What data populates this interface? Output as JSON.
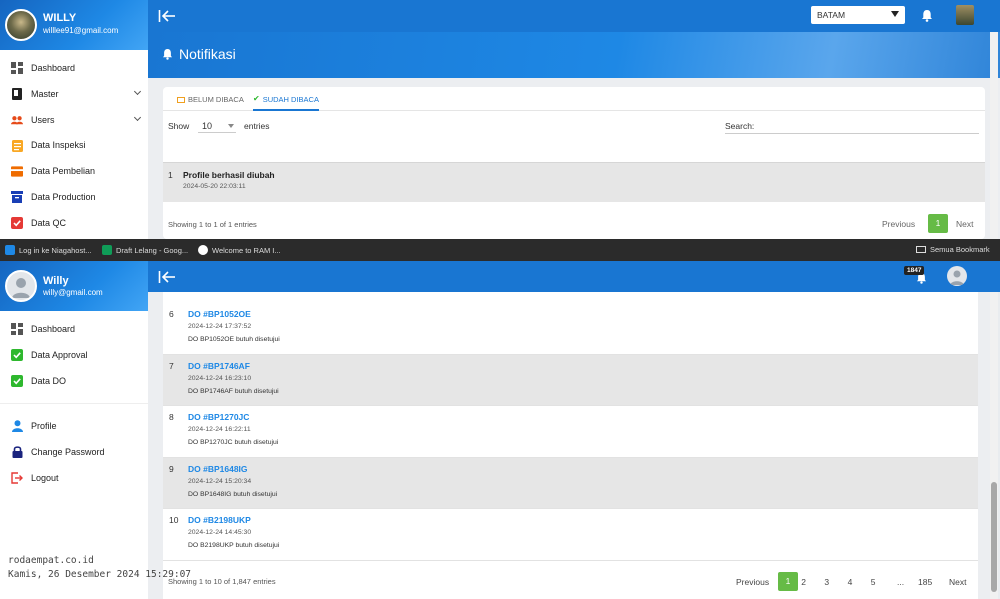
{
  "top": {
    "user": {
      "name": "WILLY",
      "email": "willlee91@gmail.com"
    },
    "menu": [
      {
        "label": "Dashboard",
        "icon": "dashboard-icon",
        "color": "#555555"
      },
      {
        "label": "Master",
        "icon": "book-icon",
        "color": "#222222",
        "has_submenu": true
      },
      {
        "label": "Users",
        "icon": "users-icon",
        "color": "#e64a19",
        "has_submenu": true
      },
      {
        "label": "Data Inspeksi",
        "icon": "clipboard-icon",
        "color": "#f9a825"
      },
      {
        "label": "Data Pembelian",
        "icon": "receipt-icon",
        "color": "#ef6c00"
      },
      {
        "label": "Data Production",
        "icon": "archive-icon",
        "color": "#1a3fb5"
      },
      {
        "label": "Data QC",
        "icon": "check-square-icon",
        "color": "#e53935"
      }
    ],
    "location_select": "BATAM",
    "page_title": "Notifikasi",
    "tabs": [
      {
        "label": "BELUM DIBACA",
        "icon": "envelope-icon",
        "active": false
      },
      {
        "label": "SUDAH DIBACA",
        "icon": "check-icon",
        "active": true
      }
    ],
    "show_label": "Show",
    "entries_value": "10",
    "entries_label": "entries",
    "search_label": "Search:",
    "rows": [
      {
        "no": "1",
        "title": "Profile berhasil diubah",
        "time": "2024-05-20 22:03:11"
      }
    ],
    "info": "Showing 1 to 1 of 1 entries",
    "pagination": {
      "prev": "Previous",
      "pages": [
        "1"
      ],
      "next": "Next"
    }
  },
  "bookmarks": {
    "items": [
      {
        "label": "Log in ke Niagahost...",
        "color": "#1e88e5"
      },
      {
        "label": "Draft Lelang - Goog...",
        "color": "#0f9d58"
      },
      {
        "label": "Welcome to RAM I...",
        "color": "#ffffff"
      }
    ],
    "folder": "Semua Bookmark"
  },
  "bottom": {
    "user": {
      "name": "Willy",
      "email": "willy@gmail.com"
    },
    "menu": [
      {
        "label": "Dashboard",
        "icon": "dashboard-icon",
        "color": "#555555"
      },
      {
        "label": "Data Approval",
        "icon": "check-square-icon",
        "color": "#2eb82e"
      },
      {
        "label": "Data DO",
        "icon": "check-square-icon",
        "color": "#2eb82e"
      }
    ],
    "menu2": [
      {
        "label": "Profile",
        "icon": "person-icon",
        "color": "#1e88e5"
      },
      {
        "label": "Change Password",
        "icon": "lock-icon",
        "color": "#1a237e"
      },
      {
        "label": "Logout",
        "icon": "logout-icon",
        "color": "#e53935"
      }
    ],
    "notif_badge": "1847",
    "rows": [
      {
        "no": "6",
        "title": "DO #BP1052OE",
        "time": "2024-12-24 17:37:52",
        "desc": "DO BP1052OE butuh disetujui"
      },
      {
        "no": "7",
        "title": "DO #BP1746AF",
        "time": "2024-12-24 16:23:10",
        "desc": "DO BP1746AF butuh disetujui"
      },
      {
        "no": "8",
        "title": "DO #BP1270JC",
        "time": "2024-12-24 16:22:11",
        "desc": "DO BP1270JC butuh disetujui"
      },
      {
        "no": "9",
        "title": "DO #BP1648IG",
        "time": "2024-12-24 15:20:34",
        "desc": "DO BP1648IG butuh disetujui"
      },
      {
        "no": "10",
        "title": "DO #B2198UKP",
        "time": "2024-12-24 14:45:30",
        "desc": "DO B2198UKP butuh disetujui"
      }
    ],
    "info": "Showing 1 to 10 of 1,847 entries",
    "pagination": {
      "prev": "Previous",
      "pages": [
        "1",
        "2",
        "3",
        "4",
        "5"
      ],
      "ellipsis": "...",
      "last": "185",
      "next": "Next"
    }
  },
  "watermark": {
    "line1": "rodaempat.co.id",
    "line2": "Kamis, 26 Desember 2024 15:29:07"
  },
  "colors": {
    "primary": "#1976d2",
    "accent_green": "#66bb46",
    "link_blue": "#1e88e5"
  }
}
